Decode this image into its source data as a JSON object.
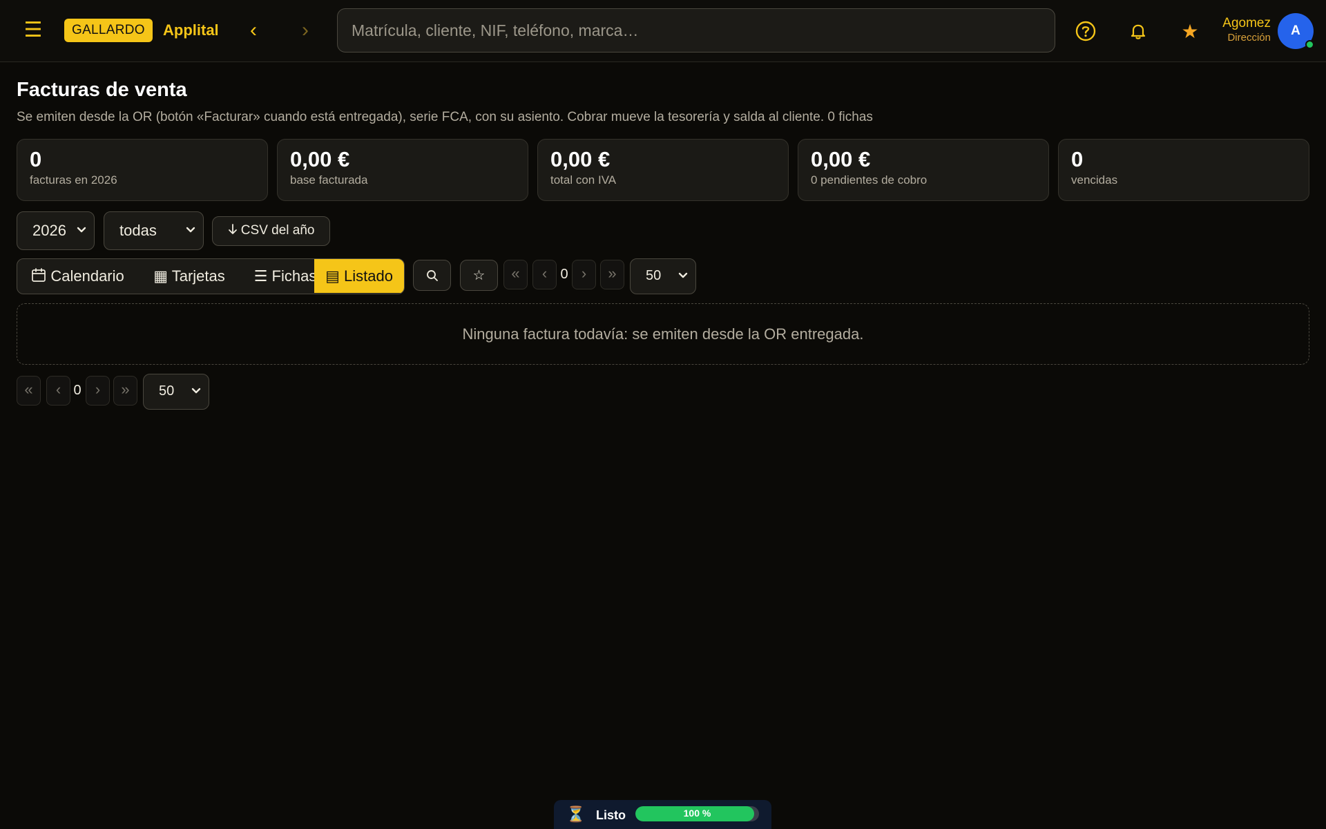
{
  "header": {
    "menu_icon": "hamburger-icon",
    "brand_badge": "GALLARDO",
    "brand_name": "Applital",
    "back_glyph": "‹",
    "forward_glyph": "›",
    "search_placeholder": "Matrícula, cliente, NIF, teléfono, marca…",
    "user": {
      "name": "Agomez",
      "role": "Dirección",
      "avatar_initial": "A",
      "online": true
    }
  },
  "page": {
    "title": "Facturas de venta",
    "subtitle": "Se emiten desde la OR (botón «Facturar» cuando está entregada), serie FCA, con su asiento. Cobrar mueve la tesorería y salda al cliente. 0 fichas"
  },
  "kpis": [
    {
      "value": "0",
      "label": "facturas en 2026"
    },
    {
      "value": "0,00 €",
      "label": "base facturada"
    },
    {
      "value": "0,00 €",
      "label": "total con IVA"
    },
    {
      "value": "0,00 €",
      "label": "0 pendientes de cobro"
    },
    {
      "value": "0",
      "label": "vencidas"
    }
  ],
  "filters": {
    "year": "2026",
    "status": "todas",
    "csv_button": "CSV del año"
  },
  "views": {
    "tabs": [
      {
        "label": "Calendario",
        "icon": "calendar-icon"
      },
      {
        "label": "Tarjetas",
        "icon": "grid-icon"
      },
      {
        "label": "Fichas",
        "icon": "list-icon"
      },
      {
        "label": "Listado",
        "icon": "table-icon"
      }
    ],
    "active": "Listado"
  },
  "pagination": {
    "first": "«",
    "prev": "‹",
    "next": "›",
    "last": "»",
    "page": "0",
    "page_size": "50"
  },
  "empty_state": "Ninguna factura todavía: se emiten desde la OR entregada.",
  "status_bar": {
    "icon": "hourglass-icon",
    "label": "Listo",
    "progress_text": "100 %",
    "progress": 0.96
  },
  "colors": {
    "accent": "#f5c518",
    "background": "#0b0a07",
    "avatar": "#2563eb",
    "success": "#22c55e"
  }
}
